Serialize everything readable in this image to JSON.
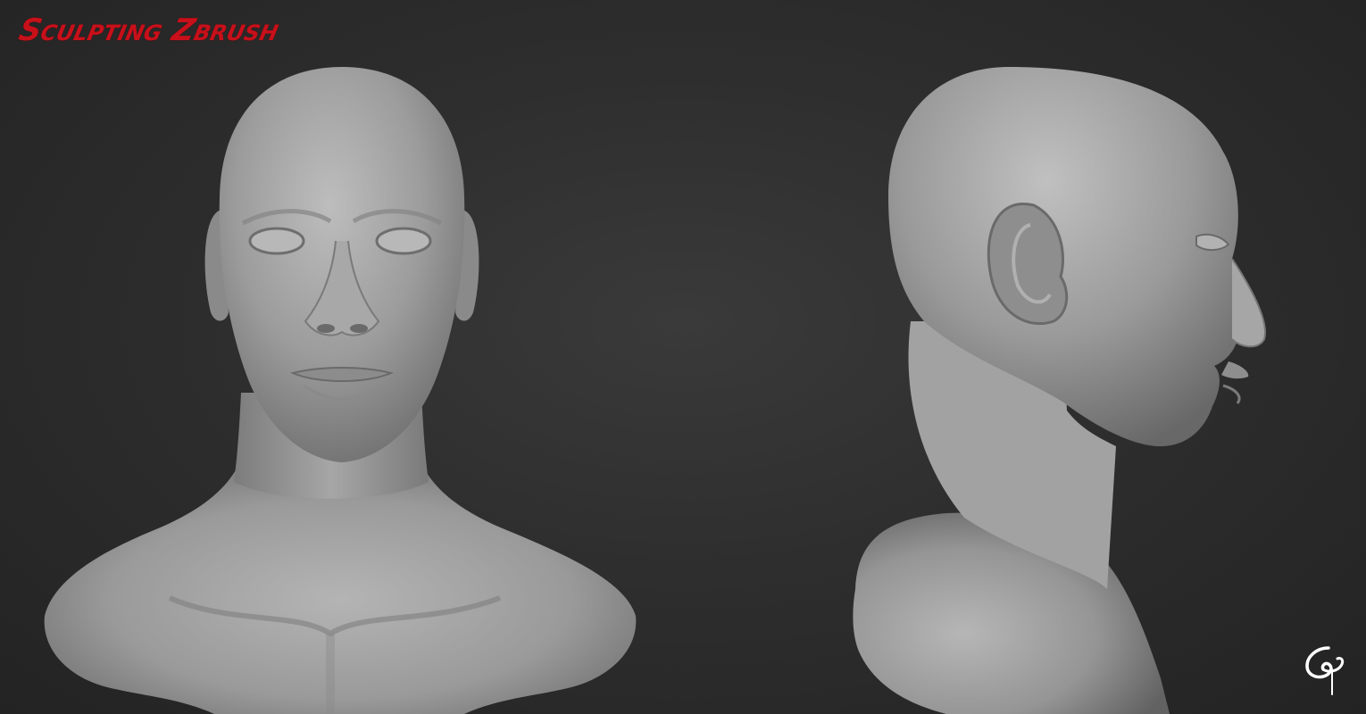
{
  "header": {
    "title": "Sculpting Zbrush"
  },
  "renders": [
    {
      "view": "front",
      "icon": "bust-front-icon"
    },
    {
      "view": "side",
      "icon": "bust-side-icon"
    }
  ],
  "signature": {
    "icon": "artist-signature-logo"
  },
  "colors": {
    "background": "#2e2e2e",
    "title": "#c8101a",
    "clay": "#9a9a9a",
    "signature": "#ffffff"
  }
}
